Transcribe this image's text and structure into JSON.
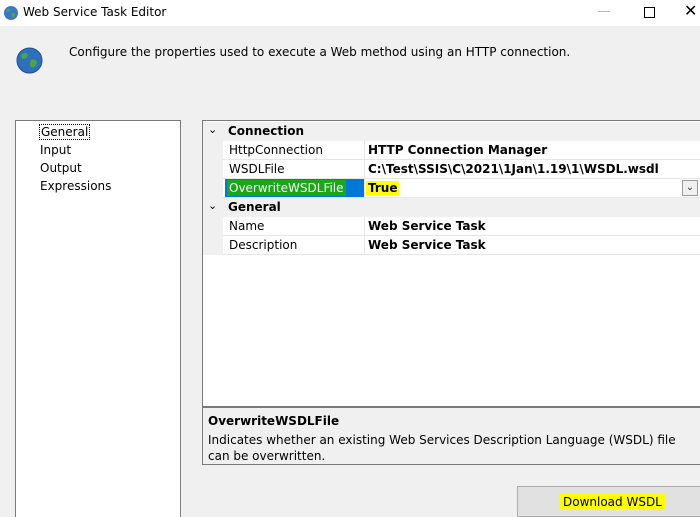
{
  "window": {
    "title": "Web Service Task Editor",
    "close_glyph": "✕"
  },
  "header": {
    "description": "Configure the properties used to execute a Web method using an HTTP connection."
  },
  "nav": {
    "items": [
      {
        "label": "General",
        "selected": true
      },
      {
        "label": "Input",
        "selected": false
      },
      {
        "label": "Output",
        "selected": false
      },
      {
        "label": "Expressions",
        "selected": false
      }
    ]
  },
  "grid": {
    "categories": [
      {
        "label": "Connection",
        "properties": [
          {
            "name": "HttpConnection",
            "value": "HTTP Connection Manager"
          },
          {
            "name": "WSDLFile",
            "value": "C:\\Test\\SSIS\\C\\2021\\1Jan\\1.19\\1\\WSDL.wsdl"
          },
          {
            "name": "OverwriteWSDLFile",
            "value": "True"
          }
        ]
      },
      {
        "label": "General",
        "properties": [
          {
            "name": "Name",
            "value": "Web Service Task"
          },
          {
            "name": "Description",
            "value": "Web Service Task"
          }
        ]
      }
    ],
    "toggle_glyph": "⌄",
    "dropdown_glyph": "⌄"
  },
  "description_panel": {
    "title": "OverwriteWSDLFile",
    "text": "Indicates whether an existing Web Services Description Language (WSDL) file can be overwritten."
  },
  "buttons": {
    "download_wsdl": "Download WSDL"
  },
  "colors": {
    "selection_blue": "#0078d7",
    "highlight_green": "#18a818",
    "highlight_yellow": "#ffff00"
  },
  "icons": {
    "app": "globe-icon",
    "header": "globe-icon"
  }
}
